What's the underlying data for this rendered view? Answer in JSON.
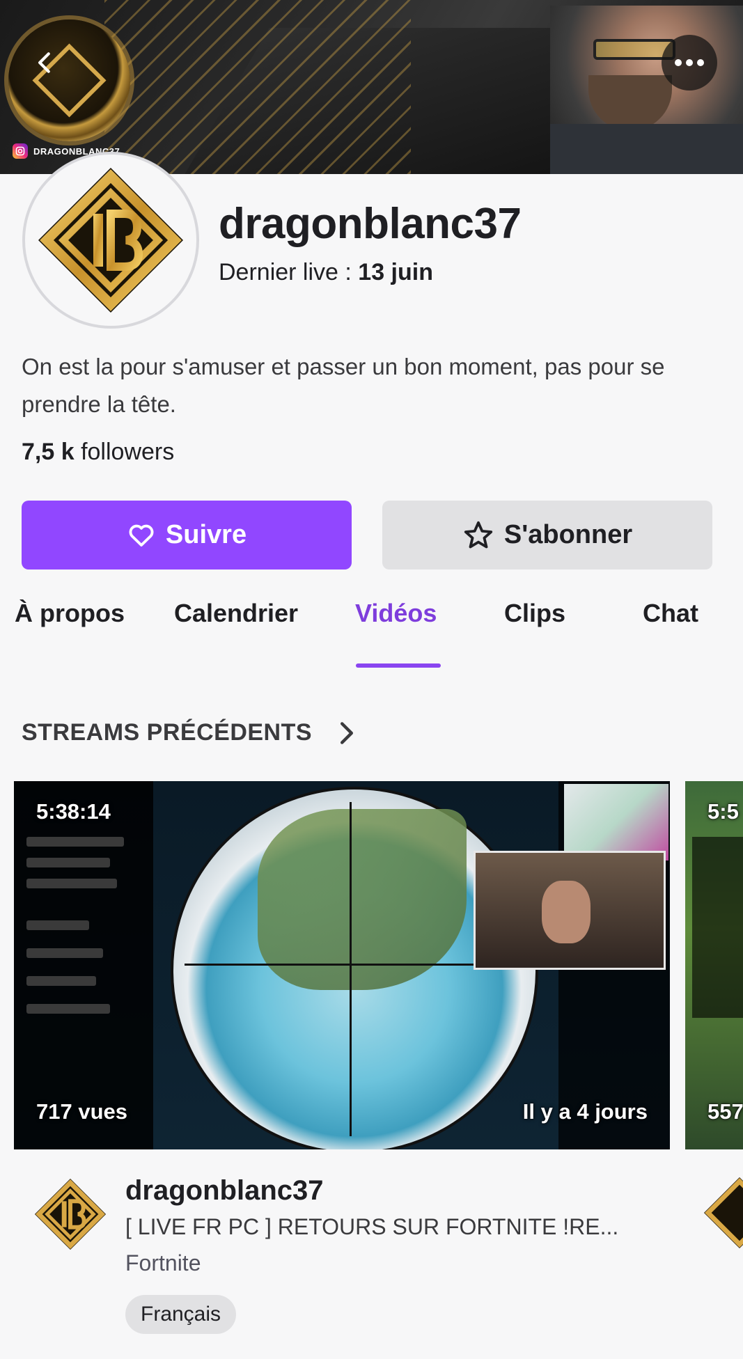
{
  "banner": {
    "instagram_handle": "DRAGONBLANC37"
  },
  "profile": {
    "channel_name": "dragonblanc37",
    "last_live_label": "Dernier live : ",
    "last_live_date": "13 juin",
    "bio": "On est la pour s'amuser et passer un bon moment, pas pour se prendre la tête.",
    "followers_count": "7,5 k",
    "followers_label": " followers"
  },
  "actions": {
    "follow_label": "Suivre",
    "subscribe_label": "S'abonner",
    "follow_color": "#9147ff"
  },
  "tabs": [
    {
      "label": "À propos",
      "active": false
    },
    {
      "label": "Calendrier",
      "active": false
    },
    {
      "label": "Vidéos",
      "active": true
    },
    {
      "label": "Clips",
      "active": false
    },
    {
      "label": "Chat",
      "active": false
    }
  ],
  "section": {
    "title": "STREAMS PRÉCÉDENTS"
  },
  "videos": [
    {
      "duration": "5:38:14",
      "views": "717 vues",
      "age": "Il y a 4 jours",
      "channel": "dragonblanc37",
      "title": "[ LIVE FR PC ]  RETOURS SUR FORTNITE !RE...",
      "game": "Fortnite",
      "tag": "Français"
    },
    {
      "duration": "5:5",
      "views": "557"
    }
  ],
  "accent_color": "#9147ff",
  "icons": [
    "back-arrow-icon",
    "more-dots-icon",
    "instagram-icon",
    "heart-icon",
    "star-icon",
    "chevron-right-icon"
  ]
}
